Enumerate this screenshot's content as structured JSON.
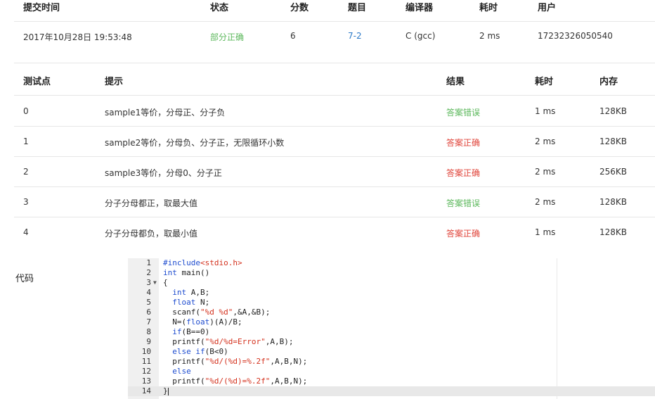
{
  "submission": {
    "headers": [
      "提交时间",
      "状态",
      "分数",
      "题目",
      "编译器",
      "耗时",
      "用户"
    ],
    "row": {
      "time": "2017年10月28日 19:53:48",
      "status": "部分正确",
      "score": "6",
      "problem": "7-2",
      "compiler": "C (gcc)",
      "elapsed": "2 ms",
      "user": "17232326050540"
    }
  },
  "testcases": {
    "headers": [
      "测试点",
      "提示",
      "结果",
      "耗时",
      "内存"
    ],
    "rows": [
      {
        "id": "0",
        "hint": "sample1等价，分母正、分子负",
        "result": "答案错误",
        "time": "1 ms",
        "memory": "128KB",
        "result_color": "#5cb85c"
      },
      {
        "id": "1",
        "hint": "sample2等价，分母负、分子正，无限循环小数",
        "result": "答案正确",
        "time": "2 ms",
        "memory": "128KB",
        "result_color": "#e0453b"
      },
      {
        "id": "2",
        "hint": "sample3等价，分母0、分子正",
        "result": "答案正确",
        "time": "2 ms",
        "memory": "256KB",
        "result_color": "#e0453b"
      },
      {
        "id": "3",
        "hint": "分子分母都正，取最大值",
        "result": "答案错误",
        "time": "2 ms",
        "memory": "128KB",
        "result_color": "#5cb85c"
      },
      {
        "id": "4",
        "hint": "分子分母都负，取最小值",
        "result": "答案正确",
        "time": "1 ms",
        "memory": "128KB",
        "result_color": "#e0453b"
      }
    ]
  },
  "code": {
    "label": "代码",
    "active_line": 14,
    "lines": [
      "#include<stdio.h>",
      "int main()",
      "{",
      "  int A,B;",
      "  float N;",
      "  scanf(\"%d %d\",&A,&B);",
      "  N=(float)(A)/B;",
      "  if(B==0)",
      "  printf(\"%d/%d=Error\",A,B);",
      "  else if(B<0)",
      "  printf(\"%d/(%d)=%.2f\",A,B,N);",
      "  else",
      "  printf(\"%d/(%d)=%.2f\",A,B,N);",
      "}"
    ],
    "line_numbers": [
      "1",
      "2",
      "3",
      "4",
      "5",
      "6",
      "7",
      "8",
      "9",
      "10",
      "11",
      "12",
      "13",
      "14"
    ]
  }
}
